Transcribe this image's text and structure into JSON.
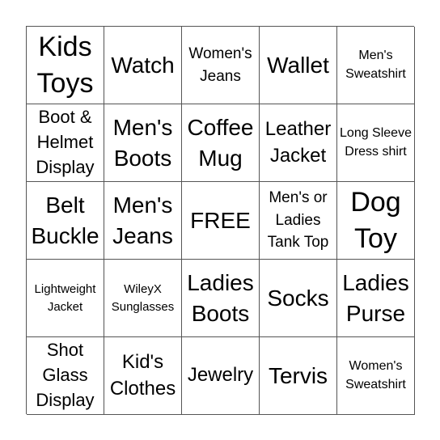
{
  "board": {
    "cells": [
      {
        "text": "Kids Toys",
        "size": "s-xl"
      },
      {
        "text": "Watch",
        "size": "s-lg"
      },
      {
        "text": "Women's Jeans",
        "size": "s-xs"
      },
      {
        "text": "Wallet",
        "size": "s-lg"
      },
      {
        "text": "Men's Sweatshirt",
        "size": "s-xxs"
      },
      {
        "text": "Boot & Helmet Display",
        "size": "s-sm"
      },
      {
        "text": "Men's Boots",
        "size": "s-lg"
      },
      {
        "text": "Coffee Mug",
        "size": "s-lg"
      },
      {
        "text": "Leather Jacket",
        "size": "s-md"
      },
      {
        "text": "Long Sleeve Dress shirt",
        "size": "s-xxs"
      },
      {
        "text": "Belt Buckle",
        "size": "s-lg"
      },
      {
        "text": "Men's Jeans",
        "size": "s-lg"
      },
      {
        "text": "FREE",
        "size": "s-lg"
      },
      {
        "text": "Men's or Ladies Tank Top",
        "size": "s-xs"
      },
      {
        "text": "Dog Toy",
        "size": "s-xl"
      },
      {
        "text": "Lightweight Jacket",
        "size": "s-tiny"
      },
      {
        "text": "WileyX Sunglasses",
        "size": "s-tiny"
      },
      {
        "text": "Ladies Boots",
        "size": "s-lg"
      },
      {
        "text": "Socks",
        "size": "s-lg"
      },
      {
        "text": "Ladies Purse",
        "size": "s-lg"
      },
      {
        "text": "Shot Glass Display",
        "size": "s-sm"
      },
      {
        "text": "Kid's Clothes",
        "size": "s-md"
      },
      {
        "text": "Jewelry",
        "size": "s-md"
      },
      {
        "text": "Tervis",
        "size": "s-lg"
      },
      {
        "text": "Women's Sweatshirt",
        "size": "s-xxs"
      }
    ]
  }
}
